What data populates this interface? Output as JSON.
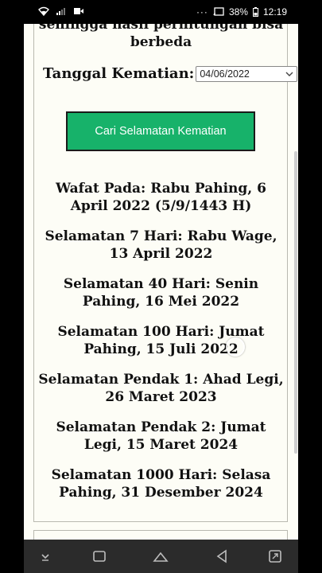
{
  "status_bar": {
    "battery": "38%",
    "time": "12:19"
  },
  "page": {
    "intro_text": "sehingga hasil perhitungan bisa berbeda",
    "date_label": "Tanggal Kematian:",
    "date_value": "04/06/2022",
    "search_button": "Cari Selamatan Kematian",
    "results": [
      "Wafat Pada: Rabu Pahing, 6 April 2022 (5/9/1443 H)",
      "Selamatan 7 Hari: Rabu Wage, 13 April 2022",
      "Selamatan 40 Hari: Senin Pahing, 16 Mei 2022",
      "Selamatan 100 Hari: Jumat Pahing, 15 Juli 2022",
      "Selamatan Pendak 1: Ahad Legi, 26 Maret 2023",
      "Selamatan Pendak 2: Jumat Legi, 15 Maret 2024",
      "Selamatan 1000 Hari: Selasa Pahing, 31 Desember 2024"
    ]
  },
  "colors": {
    "button_bg": "#17b26a",
    "page_bg": "#fdfdf6"
  },
  "nav_icons": [
    "keyboard-hide-icon",
    "recents-icon",
    "home-icon",
    "back-icon",
    "rotate-icon"
  ]
}
